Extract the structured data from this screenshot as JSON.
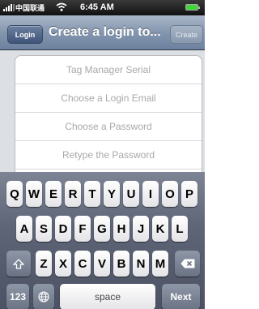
{
  "status_bar": {
    "carrier": "中国联通",
    "time": "6:45 AM"
  },
  "nav": {
    "back_label": "Login",
    "title": "Create a login to...",
    "create_label": "Create"
  },
  "form": {
    "fields": [
      {
        "placeholder": "Tag Manager Serial"
      },
      {
        "placeholder": "Choose a Login Email"
      },
      {
        "placeholder": "Choose a Password"
      },
      {
        "placeholder": "Retype the Password"
      }
    ]
  },
  "keyboard": {
    "row1": [
      "Q",
      "W",
      "E",
      "R",
      "T",
      "Y",
      "U",
      "I",
      "O",
      "P"
    ],
    "row2": [
      "A",
      "S",
      "D",
      "F",
      "G",
      "H",
      "J",
      "K",
      "L"
    ],
    "row3": [
      "Z",
      "X",
      "C",
      "V",
      "B",
      "N",
      "M"
    ],
    "numbers_label": "123",
    "space_label": "space",
    "next_label": "Next",
    "shift_icon": "shift-arrow-icon",
    "delete_icon": "backspace-icon",
    "globe_icon": "globe-icon"
  },
  "colors": {
    "nav_bar": "#8496ae",
    "keyboard_bg": "#5e6577",
    "placeholder_text": "#a8a8a8",
    "battery_fill": "#43d43d"
  }
}
